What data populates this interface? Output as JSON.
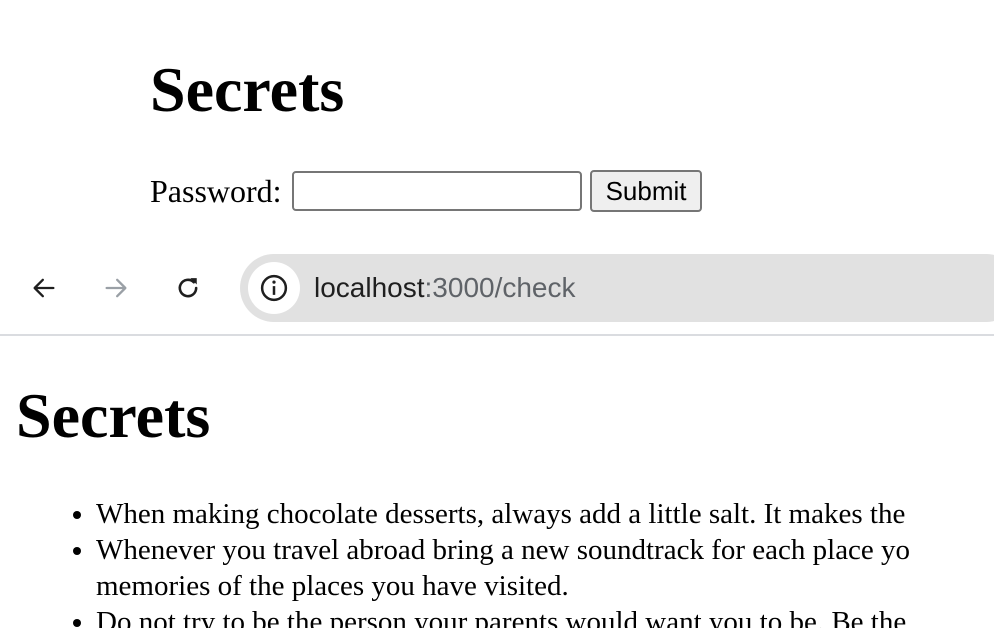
{
  "top_page": {
    "title": "Secrets",
    "password_label": "Password:",
    "password_value": "",
    "submit_label": "Submit"
  },
  "browser": {
    "url_host": "localhost",
    "url_path": ":3000/check",
    "icons": {
      "back": "arrow-left-icon",
      "forward": "arrow-right-icon",
      "reload": "reload-icon",
      "site_info": "info-icon"
    },
    "colors": {
      "toolbar_bg": "#ffffff",
      "omnibox_bg": "#e1e1e1",
      "forward_disabled": "#9aa0a6",
      "url_path": "#5f6368"
    }
  },
  "content": {
    "title": "Secrets",
    "secrets": [
      "When making chocolate desserts, always add a little salt. It makes the",
      "Whenever you travel abroad bring a new soundtrack for each place yo memories of the places you have visited.",
      "Do not try to be the person your parents would want you to be. Be the"
    ]
  }
}
